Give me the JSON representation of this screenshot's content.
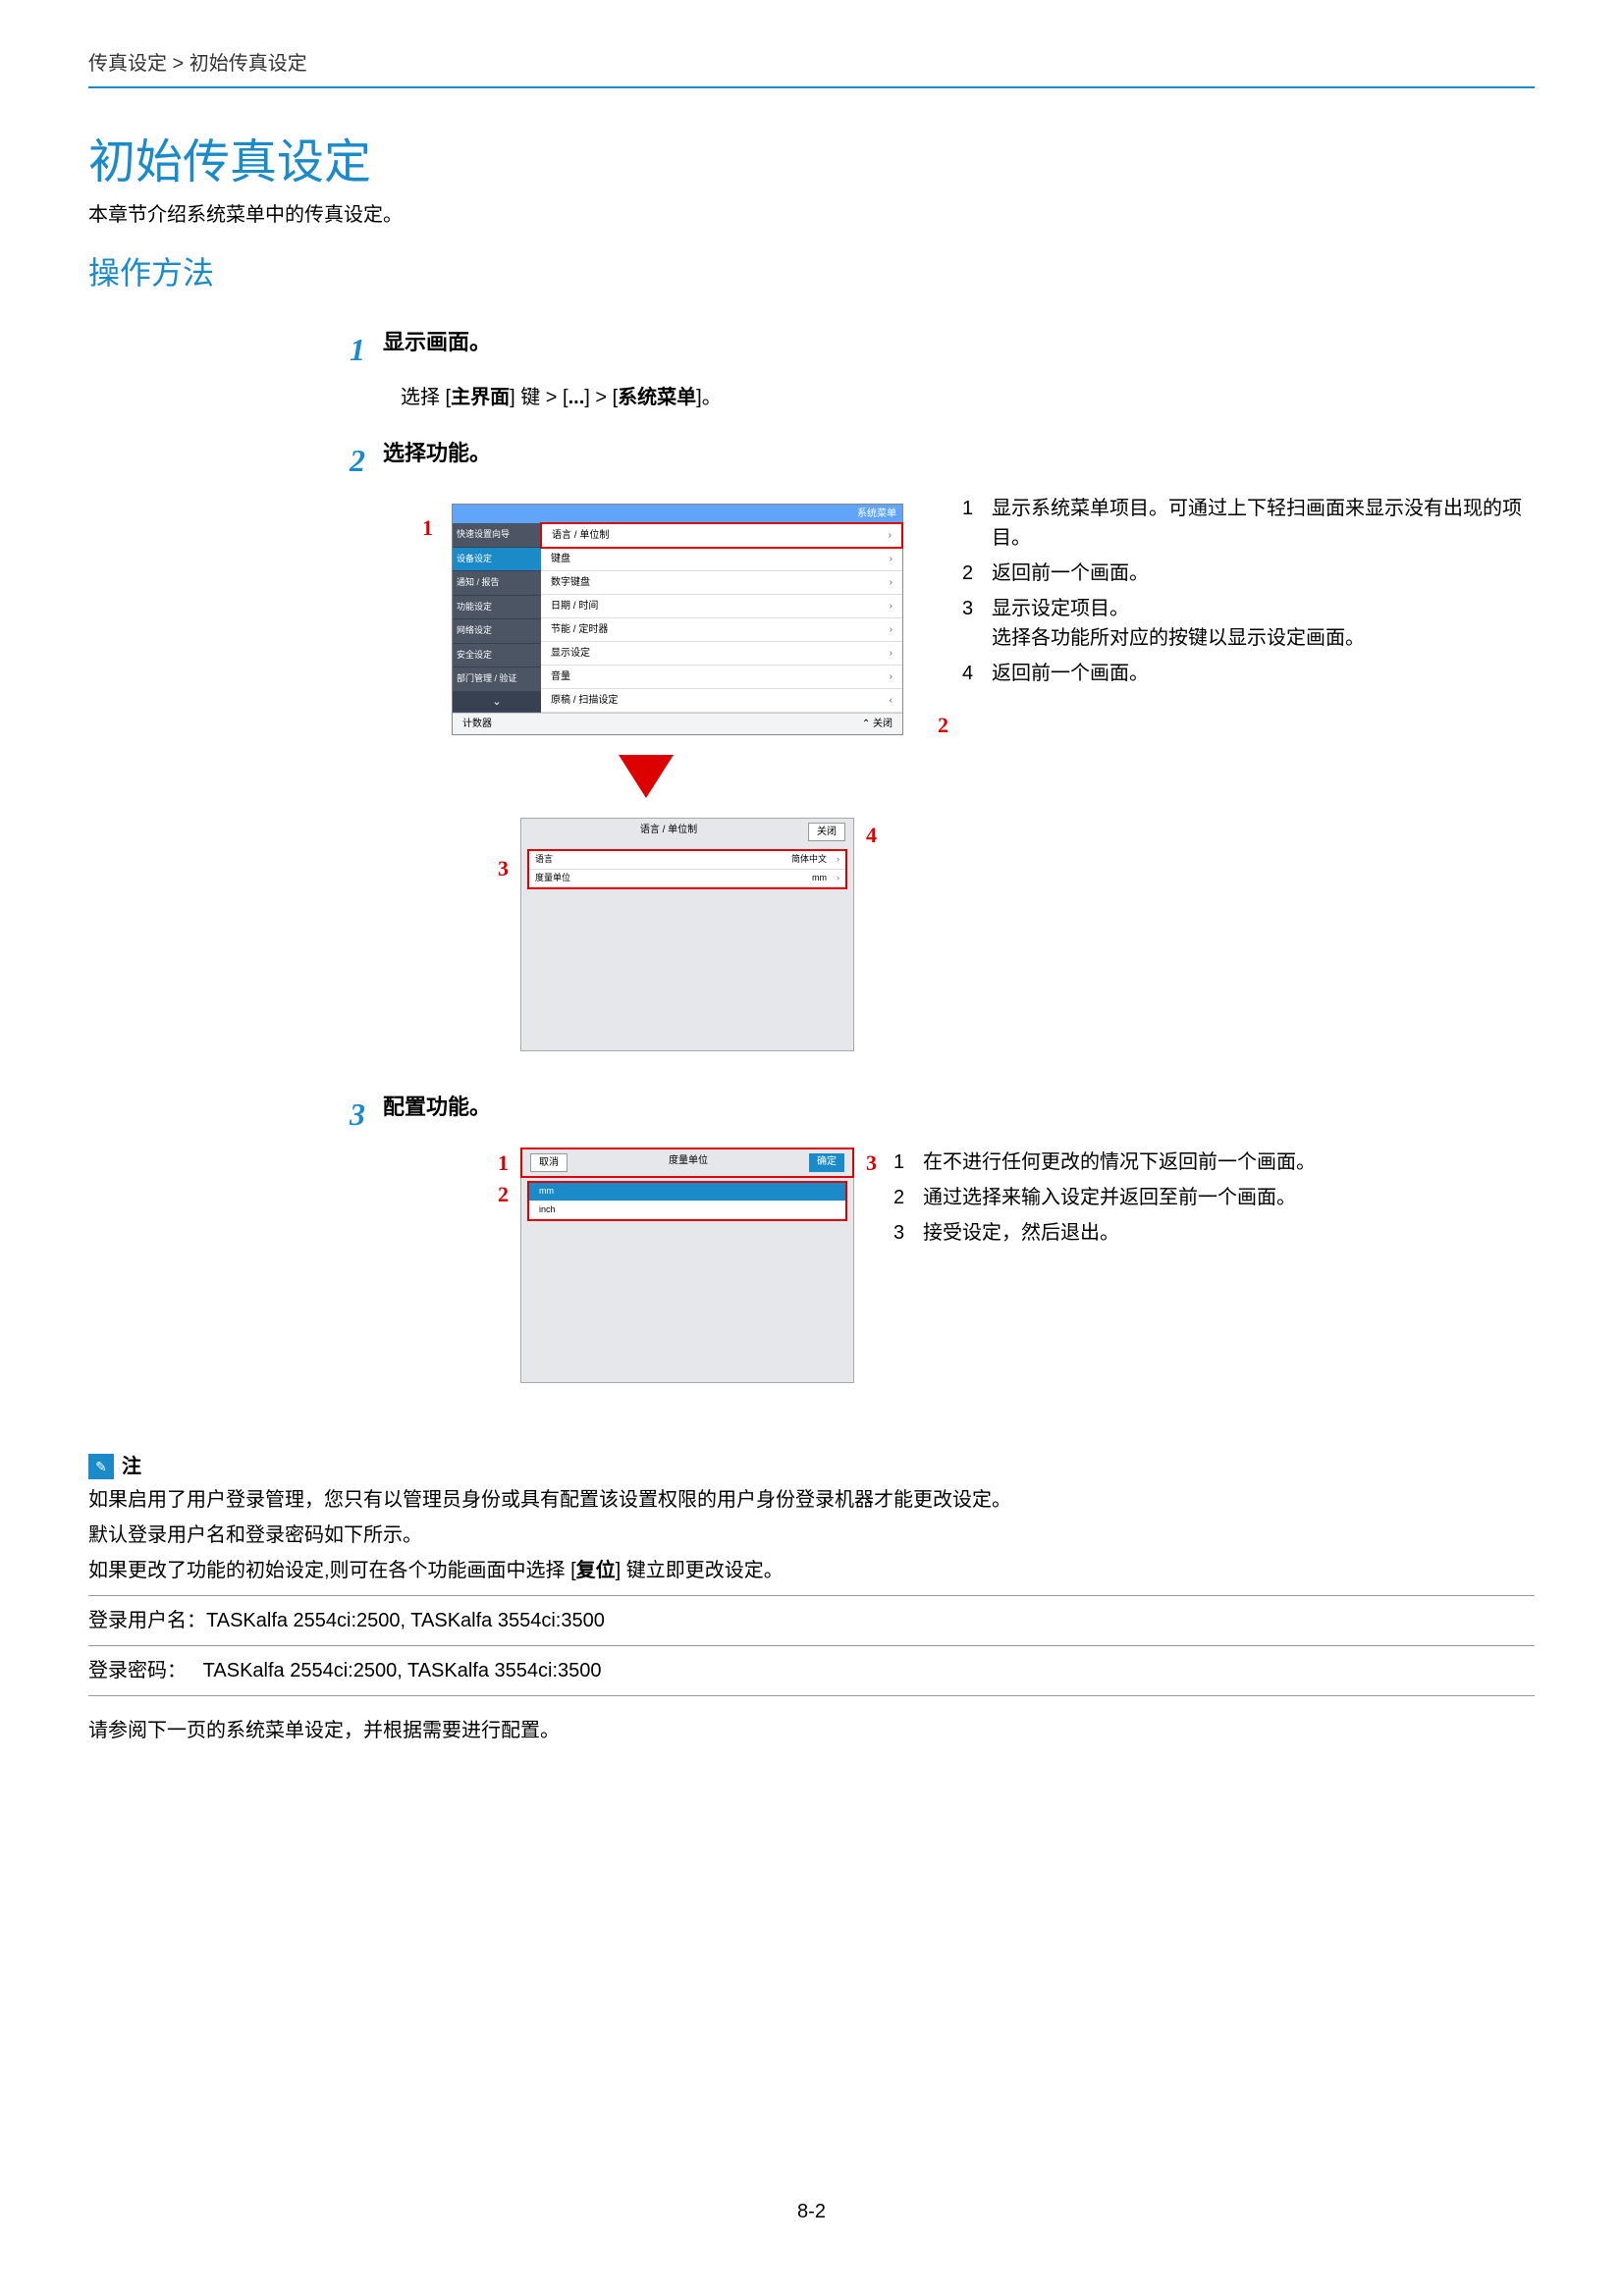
{
  "breadcrumb": "传真设定 > 初始传真设定",
  "title": "初始传真设定",
  "subtitle": "本章节介绍系统菜单中的传真设定。",
  "section": "操作方法",
  "step1": {
    "num": "1",
    "title": "显示画面。",
    "body_prefix": "选择 [",
    "body_home": "主界面",
    "body_mid1": "] 键 > [",
    "body_dots": "...",
    "body_mid2": "] > [",
    "body_sysmenu": "系统菜单",
    "body_suffix": "]。"
  },
  "step2": {
    "num": "2",
    "title": "选择功能。",
    "shot1_topbar": "系统菜单",
    "shot1_side": [
      "快速设置向导",
      "设备设定",
      "通知 / 报告",
      "功能设定",
      "网络设定",
      "安全设定",
      "部门管理 / 验证"
    ],
    "shot1_rows": [
      "语言 / 单位制",
      "键盘",
      "数字键盘",
      "日期 / 时间",
      "节能 / 定时器",
      "显示设定",
      "音量",
      "原稿 / 扫描设定"
    ],
    "shot1_counter": "计数器",
    "shot1_close": "关闭",
    "desc": [
      {
        "n": "1",
        "t": "显示系统菜单项目。可通过上下轻扫画面来显示没有出现的项目。"
      },
      {
        "n": "2",
        "t": "返回前一个画面。"
      },
      {
        "n": "3",
        "t": "显示设定项目。\n选择各功能所对应的按键以显示设定画面。"
      },
      {
        "n": "4",
        "t": "返回前一个画面。"
      }
    ],
    "shot2_title": "语言 / 单位制",
    "shot2_close": "关闭",
    "shot2_rows": [
      {
        "label": "语言",
        "val": "简体中文"
      },
      {
        "label": "度量单位",
        "val": "mm"
      }
    ]
  },
  "step3": {
    "num": "3",
    "title": "配置功能。",
    "shot3_cancel": "取消",
    "shot3_title": "度量单位",
    "shot3_ok": "确定",
    "shot3_opts": [
      "mm",
      "inch"
    ],
    "desc": [
      {
        "n": "1",
        "t": "在不进行任何更改的情况下返回前一个画面。"
      },
      {
        "n": "2",
        "t": "通过选择来输入设定并返回至前一个画面。"
      },
      {
        "n": "3",
        "t": "接受设定，然后退出。"
      }
    ]
  },
  "note": {
    "label": "注",
    "lines": [
      "如果启用了用户登录管理，您只有以管理员身份或具有配置该设置权限的用户身份登录机器才能更改设定。",
      "默认登录用户名和登录密码如下所示。"
    ],
    "line3_prefix": "如果更改了功能的初始设定,则可在各个功能画面中选择 [",
    "line3_key": "复位",
    "line3_suffix": "] 键立即更改设定。",
    "login_user_label": "登录用户名：",
    "login_user_val": "TASKalfa 2554ci:2500, TASKalfa 3554ci:3500",
    "login_pass_label": "登录密码：",
    "login_pass_val": "TASKalfa 2554ci:2500, TASKalfa 3554ci:3500"
  },
  "final": "请参阅下一页的系统菜单设定，并根据需要进行配置。",
  "page_num": "8-2",
  "call": {
    "c1": "1",
    "c2": "2",
    "c3": "3",
    "c4": "4"
  }
}
